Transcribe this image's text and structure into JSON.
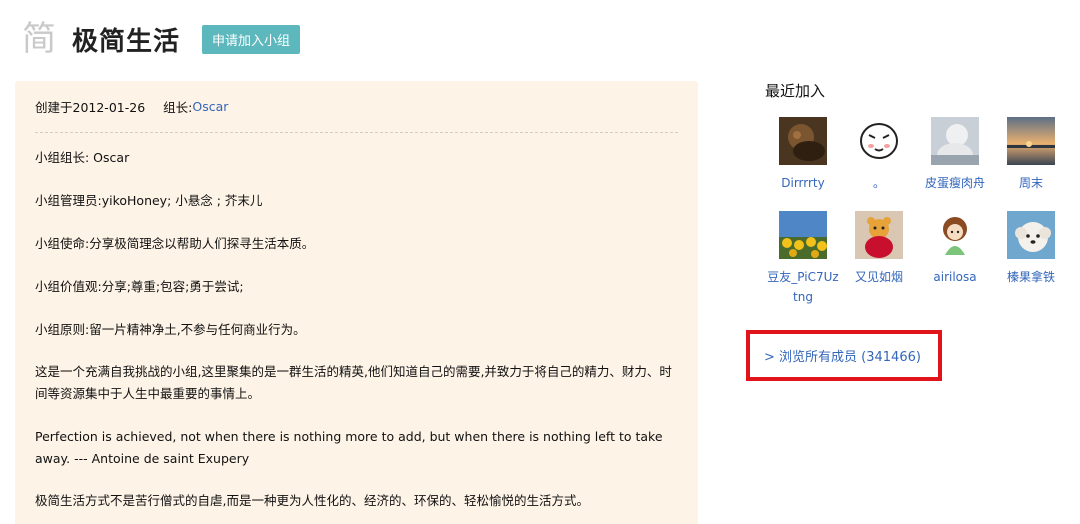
{
  "header": {
    "icon_char": "简",
    "title": "极简生活",
    "join_label": "申请加入小组"
  },
  "intro": {
    "created_label": "创建于2012-01-26",
    "owner_label": "组长:",
    "owner_name": "Oscar",
    "paragraphs": [
      "小组组长: Oscar",
      "小组管理员:yikoHoney; 小悬念 ; 芥末儿",
      "小组使命:分享极简理念以帮助人们探寻生活本质。",
      "小组价值观:分享;尊重;包容;勇于尝试;",
      "小组原则:留一片精神净土,不参与任何商业行为。",
      "这是一个充满自我挑战的小组,这里聚集的是一群生活的精英,他们知道自己的需要,并致力于将自己的精力、财力、时间等资源集中于人生中最重要的事情上。",
      "Perfection is achieved, not when there is nothing more to add, but when there is nothing left to take away. --- Antoine de saint Exupery",
      "极简生活方式不是苦行僧式的自虐,而是一种更为人性化的、经济的、环保的、轻松愉悦的生活方式。"
    ]
  },
  "sidebar": {
    "title": "最近加入",
    "members": [
      {
        "name": "Dirrrrty",
        "avatar": "dark-brown-photo-avatar"
      },
      {
        "name": "。",
        "avatar": "cartoon-face-avatar"
      },
      {
        "name": "皮蛋瘦肉舟",
        "avatar": "white-plush-avatar"
      },
      {
        "name": "周末",
        "avatar": "sunset-lake-avatar"
      },
      {
        "name": "豆友_PiC7Uztng",
        "avatar": "sunflowers-avatar"
      },
      {
        "name": "又见如烟",
        "avatar": "teddy-bear-avatar"
      },
      {
        "name": "airilosa",
        "avatar": "cartoon-girl-avatar"
      },
      {
        "name": "榛果拿铁",
        "avatar": "white-dog-avatar"
      }
    ],
    "browse_all_label": "> 浏览所有成员 (341466)"
  },
  "colors": {
    "link": "#3366bb",
    "join_button": "#5cb8bd",
    "intro_background": "#fdf3e7",
    "highlight_border": "#e1141c"
  }
}
